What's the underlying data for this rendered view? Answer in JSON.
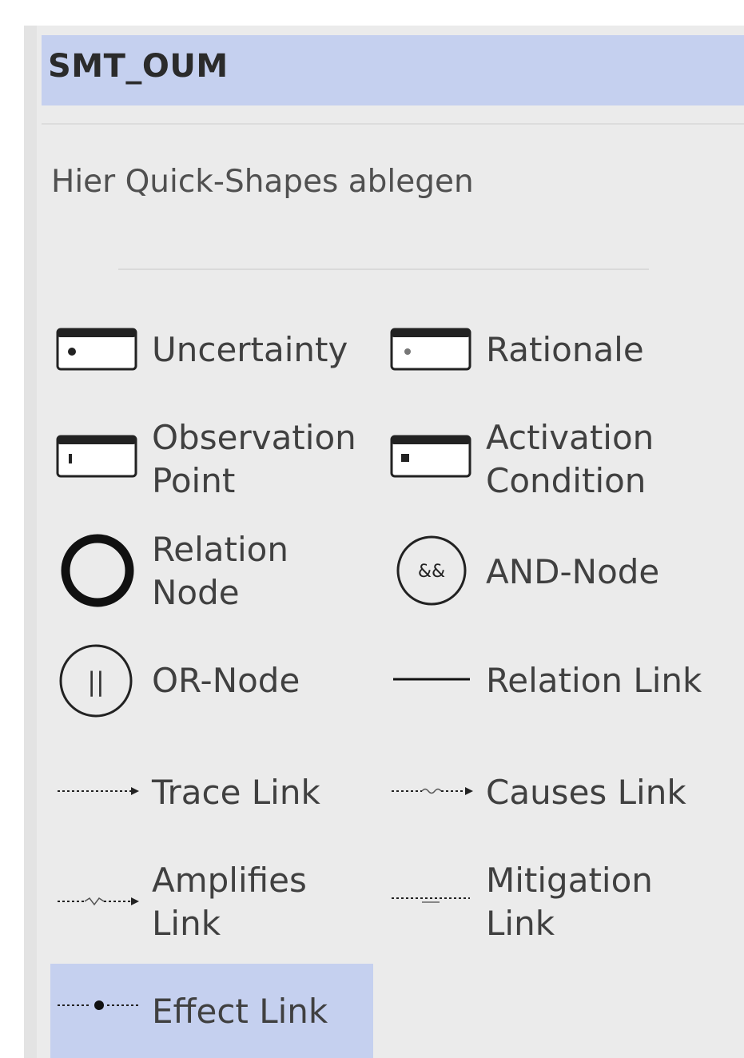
{
  "stencil": {
    "title": "SMT_OUM",
    "quick_shapes_hint": "Hier Quick-Shapes ablegen"
  },
  "shapes": [
    {
      "label_1": "Uncertainty",
      "icon": "uncertainty-card-icon"
    },
    {
      "label_1": "Rationale",
      "icon": "rationale-card-icon"
    },
    {
      "label_1": "Observation",
      "label_2": "Point",
      "icon": "observation-point-card-icon"
    },
    {
      "label_1": "Activation",
      "label_2": "Condition",
      "icon": "activation-condition-card-icon"
    },
    {
      "label_1": "Relation",
      "label_2": "Node",
      "icon": "relation-node-circle-icon"
    },
    {
      "label_1": "AND-Node",
      "icon": "and-node-circle-icon",
      "glyph": "&&"
    },
    {
      "label_1": "OR-Node",
      "icon": "or-node-circle-icon",
      "glyph": "||"
    },
    {
      "label_1": "Relation Link",
      "icon": "solid-line-icon"
    },
    {
      "label_1": "Trace Link",
      "icon": "dotted-arrow-icon"
    },
    {
      "label_1": "Causes Link",
      "icon": "dotted-wavy-arrow-icon"
    },
    {
      "label_1": "Amplifies",
      "label_2": "Link",
      "icon": "dotted-amplify-arrow-icon"
    },
    {
      "label_1": "Mitigation",
      "label_2": "Link",
      "icon": "dotted-mitigation-line-icon"
    },
    {
      "label_1": "Effect Link",
      "icon": "dotted-dot-link-icon",
      "selected": true
    }
  ],
  "colors": {
    "pane_background": "#ebebeb",
    "header_background": "#c5d0ef",
    "selection_background": "#c5d0ef",
    "label_text": "#404040"
  }
}
